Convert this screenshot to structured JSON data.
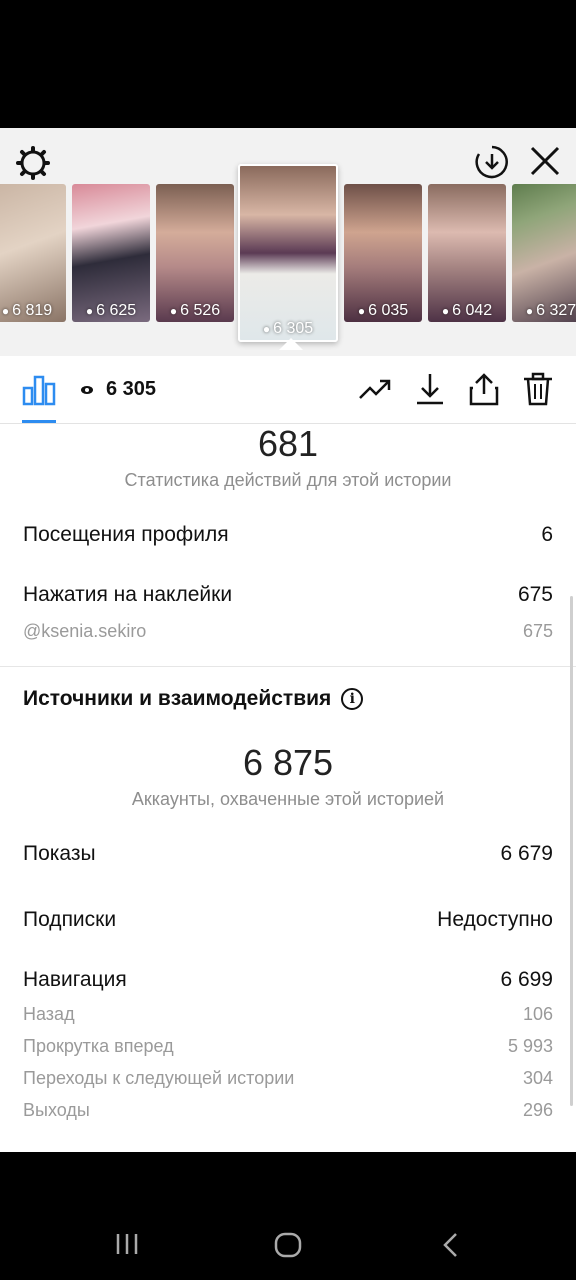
{
  "top_actions": {
    "settings_icon": "gear-icon",
    "download_icon": "download-circle-icon",
    "close_icon": "close-icon"
  },
  "stories": [
    {
      "views": "6 819",
      "colors": [
        "#b7a091",
        "#d7c3b2",
        "#6f5b52"
      ]
    },
    {
      "views": "6 625",
      "colors": [
        "#c77b8a",
        "#e8c0c7",
        "#3b3a4a"
      ]
    },
    {
      "views": "6 526",
      "colors": [
        "#9c7f72",
        "#d9b3a4",
        "#4d3545"
      ]
    },
    {
      "views": "6 305",
      "colors": [
        "#a88978",
        "#e6e1dc",
        "#4f2f46"
      ],
      "active": true,
      "handle": "@ksenia.sekiro"
    },
    {
      "views": "6 035",
      "colors": [
        "#9a7b6c",
        "#cba896",
        "#4a2f3f"
      ]
    },
    {
      "views": "6 042",
      "colors": [
        "#b7968c",
        "#d7b8ae",
        "#503347"
      ]
    },
    {
      "views": "6 327",
      "colors": [
        "#6d8c5c",
        "#b9a89a",
        "#3d3042"
      ]
    }
  ],
  "toolbar": {
    "views": "6 305",
    "icons": [
      "bar-chart-icon",
      "eye-icon",
      "trending-icon",
      "download-icon",
      "share-icon",
      "trash-icon"
    ]
  },
  "actions": {
    "total": "681",
    "caption": "Статистика действий для этой истории",
    "profile_visits_label": "Посещения профиля",
    "profile_visits_value": "6",
    "sticker_taps_label": "Нажатия на наклейки",
    "sticker_taps_value": "675",
    "sticker_handle_label": "@ksenia.sekiro",
    "sticker_handle_value": "675"
  },
  "discovery": {
    "title": "Источники и взаимодействия",
    "reach": "6 875",
    "reach_caption": "Аккаунты, охваченные этой историей",
    "impressions_label": "Показы",
    "impressions_value": "6 679",
    "follows_label": "Подписки",
    "follows_value": "Недоступно",
    "navigation_label": "Навигация",
    "navigation_value": "6 699",
    "back_label": "Назад",
    "back_value": "106",
    "forward_label": "Прокрутка вперед",
    "forward_value": "5 993",
    "next_story_label": "Переходы к следующей истории",
    "next_story_value": "304",
    "exits_label": "Выходы",
    "exits_value": "296"
  },
  "system_nav": {
    "recents_icon": "recents-icon",
    "home_icon": "home-icon",
    "back_icon": "back-icon"
  },
  "colors": {
    "accent": "#2d8cf0",
    "muted": "#8e8e8e"
  }
}
